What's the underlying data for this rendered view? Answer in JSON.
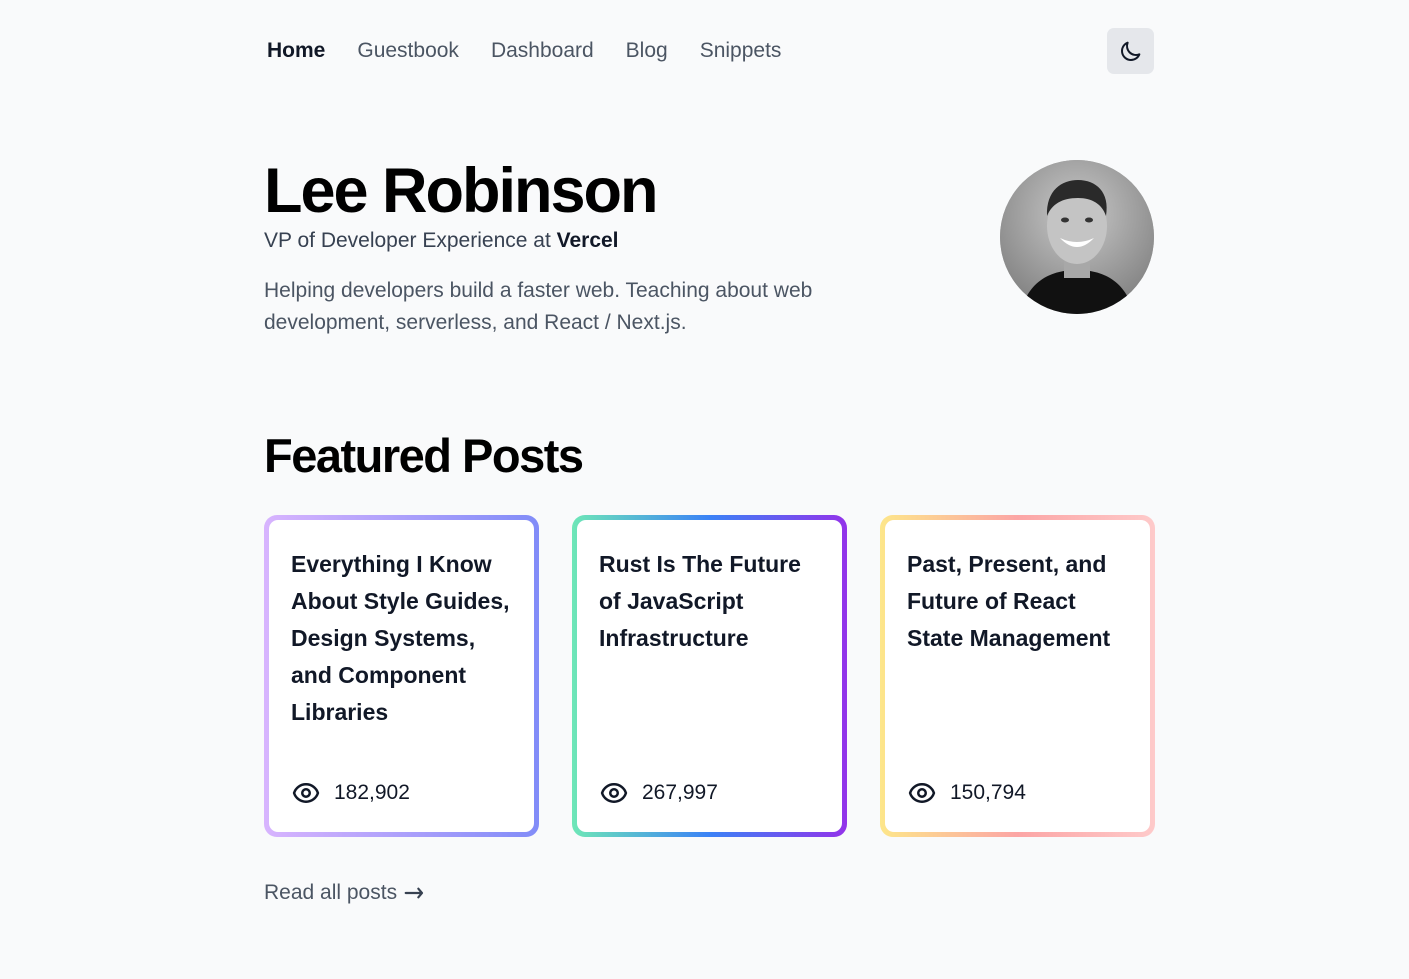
{
  "nav": {
    "links": [
      {
        "label": "Home",
        "active": true
      },
      {
        "label": "Guestbook",
        "active": false
      },
      {
        "label": "Dashboard",
        "active": false
      },
      {
        "label": "Blog",
        "active": false
      },
      {
        "label": "Snippets",
        "active": false
      }
    ],
    "theme_icon": "moon-icon"
  },
  "hero": {
    "name": "Lee Robinson",
    "role_prefix": "VP of Developer Experience at ",
    "role_company": "Vercel",
    "bio": "Helping developers build a faster web. Teaching about web development, serverless, and React / Next.js."
  },
  "featured": {
    "title": "Featured Posts",
    "posts": [
      {
        "title": "Everything I Know About Style Guides, Design Systems, and Component Libraries",
        "views": "182,902"
      },
      {
        "title": "Rust Is The Future of JavaScript Infrastructure",
        "views": "267,997"
      },
      {
        "title": "Past, Present, and Future of React State Management",
        "views": "150,794"
      }
    ],
    "view_icon": "eye-icon",
    "read_all": "Read all posts"
  }
}
